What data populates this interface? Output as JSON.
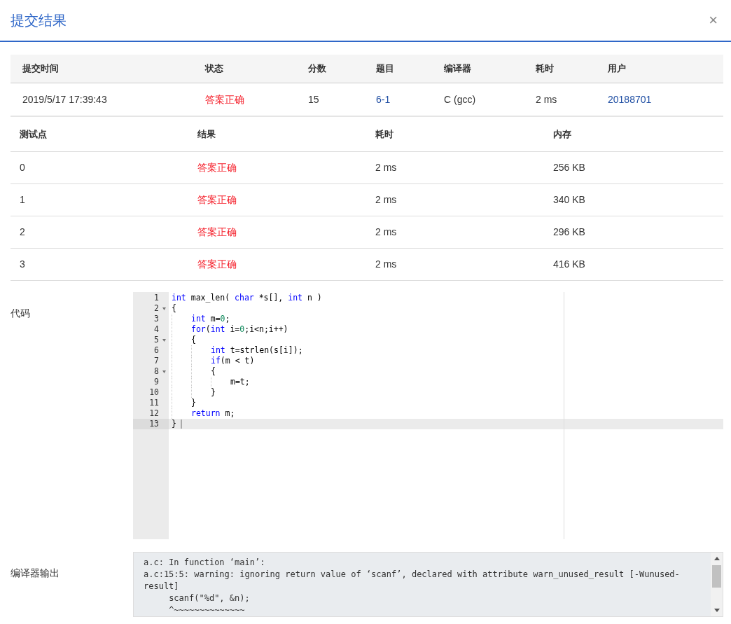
{
  "dialog": {
    "title": "提交结果",
    "close": "×"
  },
  "summary": {
    "columns": [
      "提交时间",
      "状态",
      "分数",
      "题目",
      "编译器",
      "耗时",
      "用户"
    ],
    "row": [
      {
        "text": "2019/5/17 17:39:43",
        "kind": "plain"
      },
      {
        "text": "答案正确",
        "kind": "status"
      },
      {
        "text": "15",
        "kind": "plain"
      },
      {
        "text": "6-1",
        "kind": "link"
      },
      {
        "text": "C (gcc)",
        "kind": "plain"
      },
      {
        "text": "2 ms",
        "kind": "plain"
      },
      {
        "text": "20188701",
        "kind": "link"
      }
    ]
  },
  "tests": {
    "columns": [
      "测试点",
      "结果",
      "耗时",
      "内存"
    ],
    "rows": [
      {
        "case": "0",
        "result": "答案正确",
        "time": "2 ms",
        "memory": "256 KB"
      },
      {
        "case": "1",
        "result": "答案正确",
        "time": "2 ms",
        "memory": "340 KB"
      },
      {
        "case": "2",
        "result": "答案正确",
        "time": "2 ms",
        "memory": "296 KB"
      },
      {
        "case": "3",
        "result": "答案正确",
        "time": "2 ms",
        "memory": "416 KB"
      }
    ]
  },
  "code": {
    "label": "代码",
    "lines": [
      {
        "number": "1",
        "fold": false,
        "active": false,
        "tokens": [
          {
            "kind": "keyword",
            "text": "int"
          },
          {
            "kind": "plain",
            "text": " max_len( "
          },
          {
            "kind": "keyword",
            "text": "char"
          },
          {
            "kind": "plain",
            "text": " *s[], "
          },
          {
            "kind": "keyword",
            "text": "int"
          },
          {
            "kind": "plain",
            "text": " n )"
          }
        ]
      },
      {
        "number": "2",
        "fold": true,
        "active": false,
        "tokens": [
          {
            "kind": "plain",
            "text": "{"
          }
        ],
        "children": [
          {
            "number": "3",
            "fold": false,
            "active": false,
            "tokens": [
              {
                "kind": "keyword",
                "text": "int"
              },
              {
                "kind": "plain",
                "text": " m="
              },
              {
                "kind": "number",
                "text": "0"
              },
              {
                "kind": "plain",
                "text": ";"
              }
            ]
          },
          {
            "number": "4",
            "fold": false,
            "active": false,
            "tokens": [
              {
                "kind": "keyword",
                "text": "for"
              },
              {
                "kind": "plain",
                "text": "("
              },
              {
                "kind": "keyword",
                "text": "int"
              },
              {
                "kind": "plain",
                "text": " i="
              },
              {
                "kind": "number",
                "text": "0"
              },
              {
                "kind": "plain",
                "text": ";i<n;i++)"
              }
            ]
          },
          {
            "number": "5",
            "fold": true,
            "active": false,
            "tokens": [
              {
                "kind": "plain",
                "text": "{"
              }
            ],
            "children": [
              {
                "number": "6",
                "fold": false,
                "active": false,
                "tokens": [
                  {
                    "kind": "keyword",
                    "text": "int"
                  },
                  {
                    "kind": "plain",
                    "text": " t=strlen(s[i]);"
                  }
                ]
              },
              {
                "number": "7",
                "fold": false,
                "active": false,
                "tokens": [
                  {
                    "kind": "keyword",
                    "text": "if"
                  },
                  {
                    "kind": "plain",
                    "text": "(m < t)"
                  }
                ]
              },
              {
                "number": "8",
                "fold": true,
                "active": false,
                "tokens": [
                  {
                    "kind": "plain",
                    "text": "{"
                  }
                ],
                "children": [
                  {
                    "number": "9",
                    "fold": false,
                    "active": false,
                    "tokens": [
                      {
                        "kind": "plain",
                        "text": "m=t;"
                      }
                    ]
                  }
                ]
              },
              {
                "number": "10",
                "fold": false,
                "active": false,
                "tokens": [
                  {
                    "kind": "plain",
                    "text": "}"
                  }
                ]
              }
            ]
          },
          {
            "number": "11",
            "fold": false,
            "active": false,
            "tokens": [
              {
                "kind": "plain",
                "text": "}"
              }
            ]
          },
          {
            "number": "12",
            "fold": false,
            "active": false,
            "tokens": [
              {
                "kind": "keyword",
                "text": "return"
              },
              {
                "kind": "plain",
                "text": " m;"
              }
            ]
          }
        ]
      },
      {
        "number": "13",
        "fold": false,
        "active": true,
        "tokens": [
          {
            "kind": "plain",
            "text": "}"
          }
        ]
      }
    ]
  },
  "compiler_output": {
    "label": "编译器输出",
    "lines": [
      "a.c: In function ‘main’:",
      "a.c:15:5: warning: ignoring return value of ‘scanf’, declared with attribute warn_unused_result [-Wunused-result]",
      "     scanf(\"%d\", &n);",
      "     ^~~~~~~~~~~~~~~"
    ]
  }
}
